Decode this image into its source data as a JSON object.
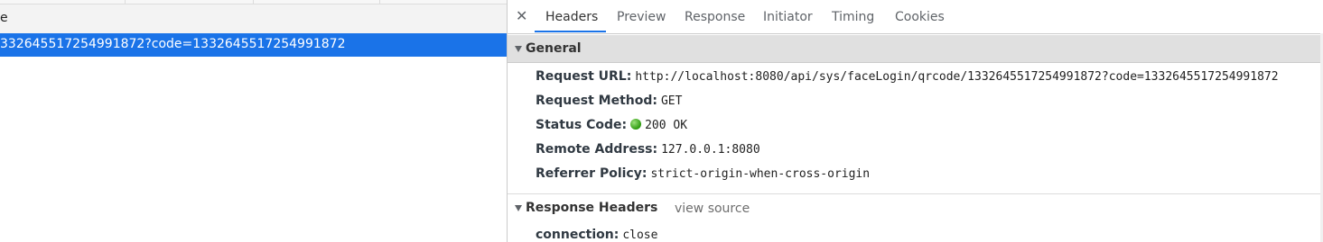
{
  "network_list": {
    "column_title": "e",
    "selected_row": "332645517254991872?code=1332645517254991872"
  },
  "detail": {
    "close_symbol": "✕",
    "tabs": [
      "Headers",
      "Preview",
      "Response",
      "Initiator",
      "Timing",
      "Cookies"
    ],
    "active_tab": "Headers",
    "general": {
      "title": "General",
      "rows": [
        {
          "key": "Request URL:",
          "value": "http://localhost:8080/api/sys/faceLogin/qrcode/1332645517254991872?code=1332645517254991872"
        },
        {
          "key": "Request Method:",
          "value": "GET"
        },
        {
          "key": "Status Code:",
          "value": "200 OK",
          "status_color": "#2c9a0e"
        },
        {
          "key": "Remote Address:",
          "value": "127.0.0.1:8080"
        },
        {
          "key": "Referrer Policy:",
          "value": "strict-origin-when-cross-origin"
        }
      ]
    },
    "response_headers": {
      "title": "Response Headers",
      "view_source": "view source",
      "rows": [
        {
          "key": "connection:",
          "value": "close"
        }
      ]
    }
  },
  "colors": {
    "accent": "#1a73e8",
    "section_bg": "#e0e0e0"
  }
}
